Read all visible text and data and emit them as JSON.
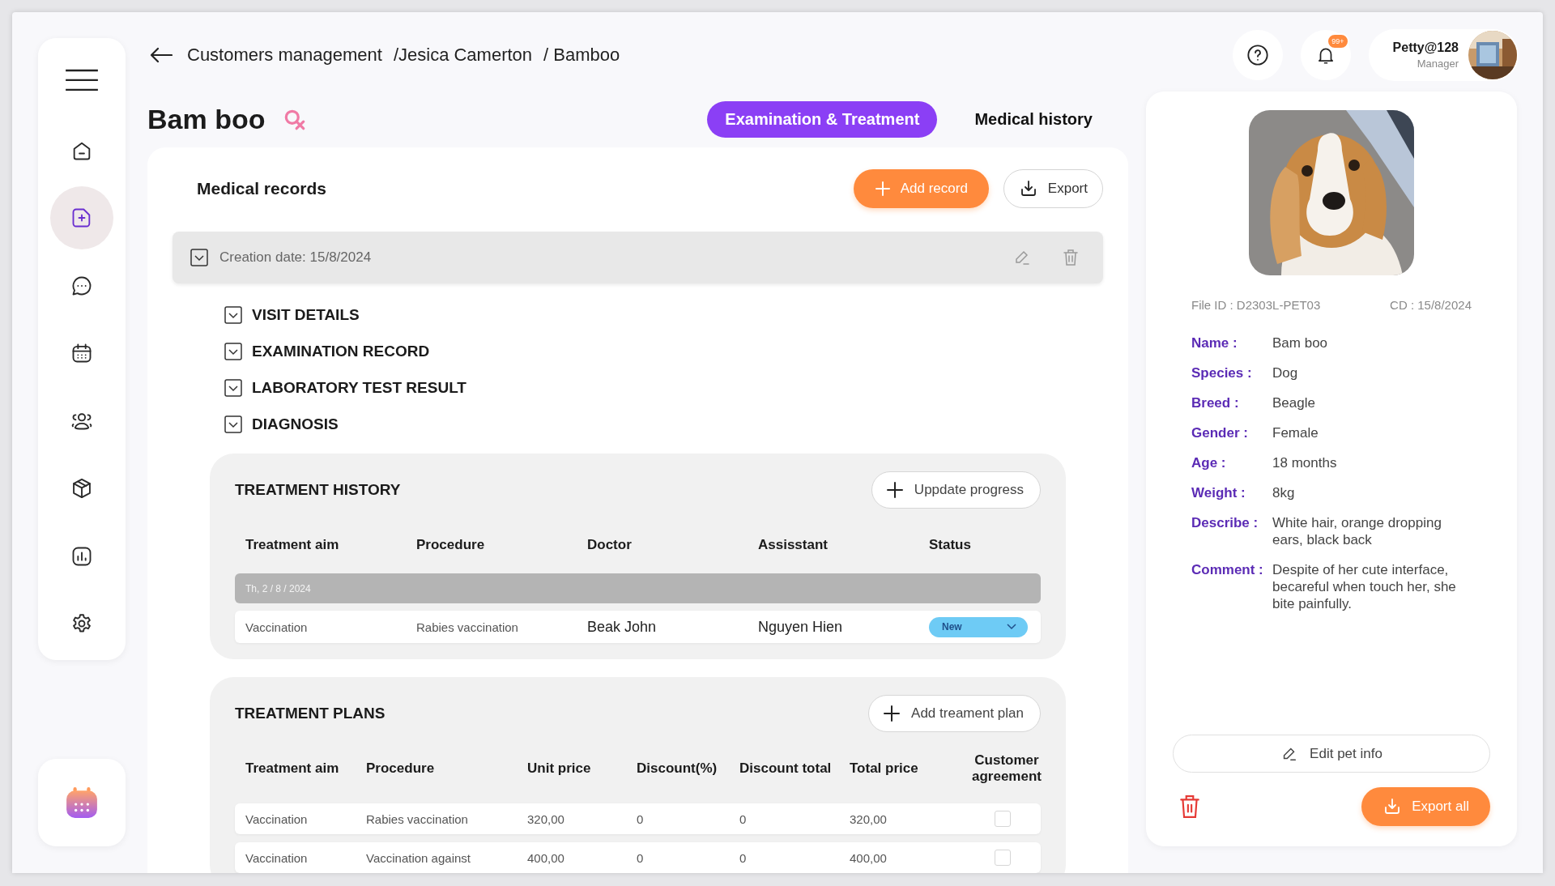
{
  "breadcrumbs": [
    {
      "label": "Customers management"
    },
    {
      "label": "/Jesica Camerton"
    },
    {
      "label": "/ Bamboo"
    }
  ],
  "sidebar": {
    "items": [
      {
        "kind": "home",
        "selected": false
      },
      {
        "kind": "record",
        "selected": true
      },
      {
        "kind": "chat",
        "selected": false
      },
      {
        "kind": "calendar",
        "selected": false
      },
      {
        "kind": "users",
        "selected": false
      },
      {
        "kind": "box",
        "selected": false
      },
      {
        "kind": "chart",
        "selected": false
      },
      {
        "kind": "settings",
        "selected": false
      }
    ]
  },
  "notifications": {
    "badge": "99+"
  },
  "user": {
    "name": "Petty@128",
    "role": "Manager"
  },
  "pet_title": "Bam boo",
  "tabs": [
    {
      "label": "Examination & Treatment",
      "selected": true
    },
    {
      "label": "Medical history",
      "selected": false
    }
  ],
  "medical_records": {
    "title": "Medical records",
    "add_button": "Add record",
    "export_button": "Export",
    "record": {
      "creation_date": "Creation date: 15/8/2024",
      "sections": [
        {
          "label": "VISIT DETAILS"
        },
        {
          "label": "EXAMINATION RECORD"
        },
        {
          "label": "LABORATORY TEST RESULT"
        },
        {
          "label": "DIAGNOSIS"
        }
      ]
    }
  },
  "treatment_history": {
    "title": "TREATMENT HISTORY",
    "button": "Uppdate progress",
    "columns": [
      "Treatment aim",
      "Procedure",
      "Doctor",
      "Assisstant",
      "Status"
    ],
    "groups": [
      {
        "date": "Th, 2 / 8 / 2024",
        "rows": [
          {
            "cells": [
              "Vaccination",
              "Rabies vaccination",
              "Beak John",
              "Nguyen Hien"
            ],
            "status": "New"
          }
        ]
      }
    ]
  },
  "treatment_plans": {
    "title": "TREATMENT PLANS",
    "button": "Add treament plan",
    "columns": [
      "Treatment aim",
      "Procedure",
      "Unit price",
      "Discount(%)",
      "Discount total",
      "Total price",
      "Customer agreement"
    ],
    "rows": [
      {
        "cells": [
          "Vaccination",
          "Rabies vaccination",
          "320,00",
          "0",
          "0",
          "320,00"
        ],
        "agreed": false
      },
      {
        "cells": [
          "Vaccination",
          "Vaccination against",
          "400,00",
          "0",
          "0",
          "400,00"
        ],
        "agreed": false
      }
    ]
  },
  "pet": {
    "file_id": "File ID : D2303L-PET03",
    "cd": "CD : 15/8/2024",
    "fields": [
      {
        "label": "Name :",
        "value": "Bam boo"
      },
      {
        "label": "Species :",
        "value": "Dog"
      },
      {
        "label": "Breed :",
        "value": "Beagle"
      },
      {
        "label": "Gender :",
        "value": "Female"
      },
      {
        "label": "Age :",
        "value": "18 months"
      },
      {
        "label": "Weight :",
        "value": "8kg"
      },
      {
        "label": "Describe :",
        "value": "White hair, orange dropping ears, black back"
      },
      {
        "label": "Comment :",
        "value": "Despite of her cute interface, becareful when touch her, she bite painfully."
      }
    ],
    "edit_button": "Edit pet info",
    "export_button": "Export all"
  }
}
